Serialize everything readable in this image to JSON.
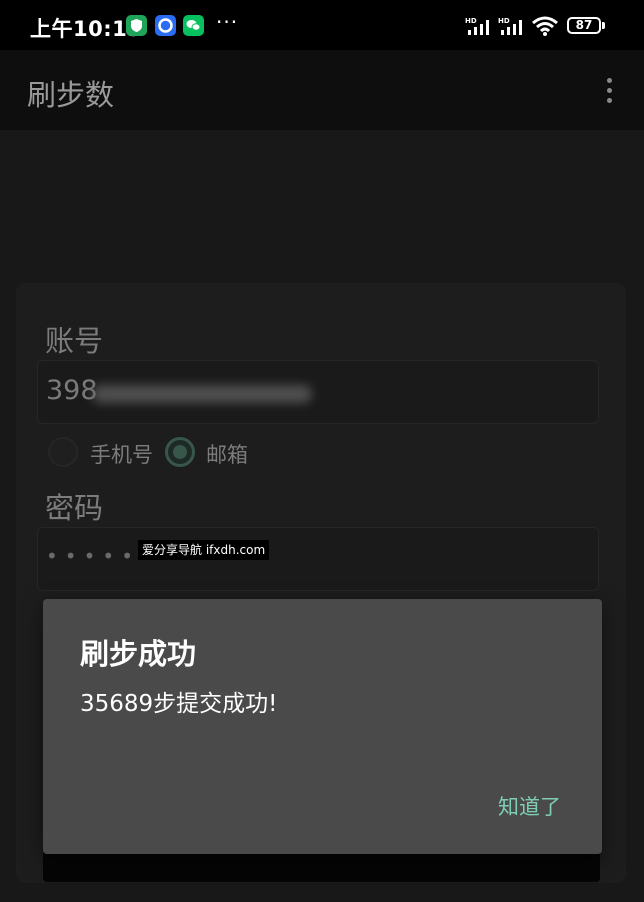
{
  "status_bar": {
    "time": "上午10:13",
    "overflow": "···",
    "battery": "87",
    "icons": [
      "security-app-icon",
      "browser-app-icon",
      "wechat-icon",
      "hd-signal-icon",
      "hd-signal-icon",
      "wifi-icon",
      "battery-icon"
    ]
  },
  "appbar": {
    "title": "刷步数",
    "menu_icon": "more-vert-icon"
  },
  "form": {
    "account_label": "账号",
    "account_value": "398",
    "radio_phone": "手机号",
    "radio_email": "邮箱",
    "selected": "邮箱",
    "password_label": "密码",
    "password_value": "••••••••"
  },
  "watermark": "爱分享导航 ifxdh.com",
  "dialog": {
    "title": "刷步成功",
    "message": "35689步提交成功!",
    "button": "知道了"
  },
  "colors": {
    "accent": "#7ecdb4",
    "dialog_bg": "#4a4a4b",
    "radio_selected": "#38564a"
  }
}
